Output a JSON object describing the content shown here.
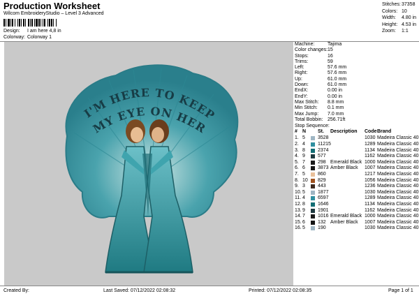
{
  "header": {
    "title": "Production Worksheet",
    "subtitle": "Wilcom EmbroideryStudio – Level 3 Advanced",
    "design_label": "Design:",
    "design_value": "I am here 4,8 in",
    "colorway_label": "Colorway:",
    "colorway_value": "Colorway 1"
  },
  "summary": [
    {
      "label": "Stitches:",
      "value": "37358"
    },
    {
      "label": "Colors:",
      "value": "10"
    },
    {
      "label": "Width:",
      "value": "4.80 in"
    },
    {
      "label": "Height:",
      "value": "4.53 in"
    },
    {
      "label": "Zoom:",
      "value": "1:1"
    }
  ],
  "design_image": {
    "text_line1": "I'M HERE TO KEEP",
    "text_line2": "MY EYE ON HER"
  },
  "machine_info": [
    {
      "label": "Machine:",
      "value": "Tajima"
    },
    {
      "label": "Color changes:",
      "value": "15"
    },
    {
      "label": "Stops:",
      "value": "16"
    },
    {
      "label": "Trims:",
      "value": "59"
    },
    {
      "label": "Left:",
      "value": "57.6 mm"
    },
    {
      "label": "Right:",
      "value": "57.6 mm"
    },
    {
      "label": "Up:",
      "value": "61.0 mm"
    },
    {
      "label": "Down:",
      "value": "61.0 mm"
    },
    {
      "label": "EndX:",
      "value": "0.00 in"
    },
    {
      "label": "EndY:",
      "value": "0.00 in"
    },
    {
      "label": "Max Stitch:",
      "value": "8.8 mm"
    },
    {
      "label": "Min Stitch:",
      "value": "0.1 mm"
    },
    {
      "label": "Max Jump:",
      "value": "7.0 mm"
    },
    {
      "label": "Total Bobbin:",
      "value": "256.71ft"
    }
  ],
  "stop_sequence": {
    "title": "Stop Sequence:",
    "headers": {
      "num": "#",
      "n": "N",
      "st": "St.",
      "desc": "Description",
      "code": "Code",
      "brand": "Brand"
    },
    "rows": [
      {
        "num": "1.",
        "n": "5",
        "color": "#9fb6c4",
        "st": "3528",
        "desc": "",
        "code": "1030",
        "brand": "Madeira Classic 40"
      },
      {
        "num": "2.",
        "n": "4",
        "color": "#2f8fa0",
        "st": "11215",
        "desc": "",
        "code": "1289",
        "brand": "Madeira Classic 40"
      },
      {
        "num": "3.",
        "n": "8",
        "color": "#126e75",
        "st": "2374",
        "desc": "",
        "code": "1134",
        "brand": "Madeira Classic 40"
      },
      {
        "num": "4.",
        "n": "9",
        "color": "#1f3a40",
        "st": "577",
        "desc": "",
        "code": "1162",
        "brand": "Madeira Classic 40"
      },
      {
        "num": "5.",
        "n": "7",
        "color": "#1b1b1b",
        "st": "298",
        "desc": "Emerald Black",
        "code": "1000",
        "brand": "Madeira Classic 40"
      },
      {
        "num": "6.",
        "n": "6",
        "color": "#151515",
        "st": "3873",
        "desc": "Amber Black",
        "code": "1007",
        "brand": "Madeira Classic 40"
      },
      {
        "num": "7.",
        "n": "5",
        "color": "#e9c09a",
        "st": "860",
        "desc": "",
        "code": "1217",
        "brand": "Madeira Classic 40"
      },
      {
        "num": "8.",
        "n": "10",
        "color": "#a0521e",
        "st": "829",
        "desc": "",
        "code": "1056",
        "brand": "Madeira Classic 40"
      },
      {
        "num": "9.",
        "n": "3",
        "color": "#3d2a1f",
        "st": "443",
        "desc": "",
        "code": "1236",
        "brand": "Madeira Classic 40"
      },
      {
        "num": "10.",
        "n": "5",
        "color": "#9fb6c4",
        "st": "1877",
        "desc": "",
        "code": "1030",
        "brand": "Madeira Classic 40"
      },
      {
        "num": "11.",
        "n": "4",
        "color": "#2f8fa0",
        "st": "6597",
        "desc": "",
        "code": "1289",
        "brand": "Madeira Classic 40"
      },
      {
        "num": "12.",
        "n": "8",
        "color": "#126e75",
        "st": "1646",
        "desc": "",
        "code": "1134",
        "brand": "Madeira Classic 40"
      },
      {
        "num": "13.",
        "n": "9",
        "color": "#1f3a40",
        "st": "1901",
        "desc": "",
        "code": "1162",
        "brand": "Madeira Classic 40"
      },
      {
        "num": "14.",
        "n": "7",
        "color": "#1b1b1b",
        "st": "1016",
        "desc": "Emerald Black",
        "code": "1000",
        "brand": "Madeira Classic 40"
      },
      {
        "num": "15.",
        "n": "6",
        "color": "#151515",
        "st": "132",
        "desc": "Amber Black",
        "code": "1007",
        "brand": "Madeira Classic 40"
      },
      {
        "num": "16.",
        "n": "5",
        "color": "#9fb6c4",
        "st": "190",
        "desc": "",
        "code": "1030",
        "brand": "Madeira Classic 40"
      }
    ]
  },
  "footer": {
    "created_by": "Created By:",
    "last_saved": "Last Saved: 07/12/2022 02:08:32",
    "printed": "Printed: 07/12/2022 02:08:35",
    "page": "Page 1 of 1"
  }
}
